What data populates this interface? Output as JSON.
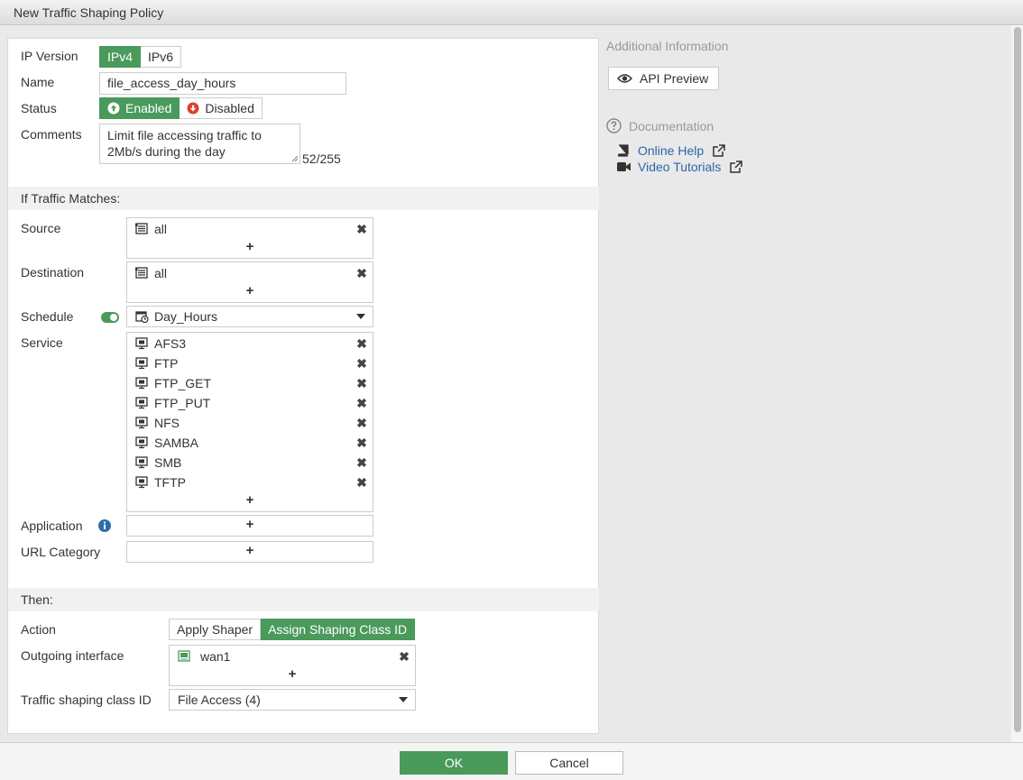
{
  "window": {
    "title": "New Traffic Shaping Policy"
  },
  "form": {
    "ip_version": {
      "label": "IP Version",
      "options": [
        "IPv4",
        "IPv6"
      ],
      "selected": "IPv4"
    },
    "name": {
      "label": "Name",
      "value": "file_access_day_hours"
    },
    "status": {
      "label": "Status",
      "enabled_label": "Enabled",
      "disabled_label": "Disabled",
      "selected": "Enabled"
    },
    "comments": {
      "label": "Comments",
      "line1": "Limit file accessing traffic to",
      "line2": "2Mb/s during the day",
      "counter": "52/255"
    }
  },
  "match": {
    "header": "If Traffic Matches:",
    "source": {
      "label": "Source",
      "items": [
        "all"
      ]
    },
    "destination": {
      "label": "Destination",
      "items": [
        "all"
      ]
    },
    "schedule": {
      "label": "Schedule",
      "value": "Day_Hours",
      "enabled": true
    },
    "service": {
      "label": "Service",
      "items": [
        "AFS3",
        "FTP",
        "FTP_GET",
        "FTP_PUT",
        "NFS",
        "SAMBA",
        "SMB",
        "TFTP"
      ]
    },
    "application": {
      "label": "Application"
    },
    "url_category": {
      "label": "URL Category"
    },
    "add_symbol": "+",
    "remove_symbol": "✖"
  },
  "then": {
    "header": "Then:",
    "action": {
      "label": "Action",
      "options": [
        "Apply Shaper",
        "Assign Shaping Class ID"
      ],
      "selected": "Assign Shaping Class ID"
    },
    "outgoing": {
      "label": "Outgoing interface",
      "items": [
        "wan1"
      ]
    },
    "class_id": {
      "label": "Traffic shaping class ID",
      "value": "File Access (4)"
    }
  },
  "sidebar": {
    "additional_info": "Additional Information",
    "api_preview": "API Preview",
    "documentation": "Documentation",
    "online_help": "Online Help",
    "video_tutorials": "Video Tutorials"
  },
  "footer": {
    "ok": "OK",
    "cancel": "Cancel"
  },
  "colors": {
    "accent": "#4a9a5c",
    "link": "#2968a8",
    "disabled_icon": "#d9412f",
    "info_icon": "#2f6da8"
  }
}
